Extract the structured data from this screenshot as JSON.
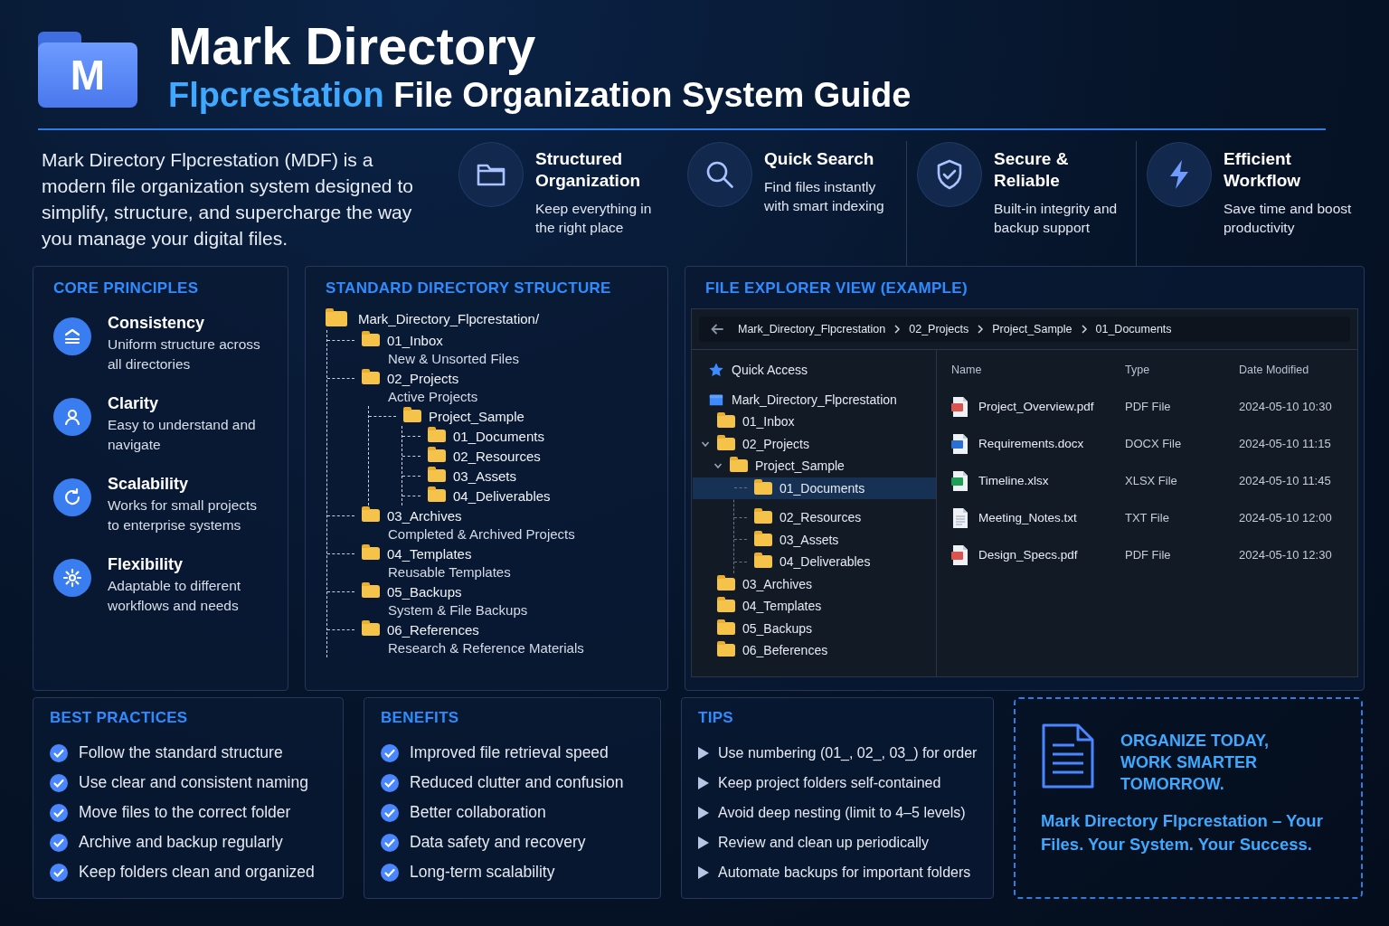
{
  "header": {
    "logo_letter": "M",
    "title": "Mark Directory",
    "subtitle_accent": "Flpcrestation",
    "subtitle_rest": "File Organization System Guide"
  },
  "intro": "Mark Directory Flpcrestation (MDF) is a modern file organization system designed to simplify, structure, and supercharge the way you manage your digital files.",
  "features": [
    {
      "kind": "folder",
      "title": "Structured Organization",
      "text": "Keep everything in the right place"
    },
    {
      "kind": "search",
      "title": "Quick Search",
      "text": "Find files instantly with smart indexing"
    },
    {
      "kind": "shield",
      "title": "Secure & Reliable",
      "text": "Built-in integrity and backup support"
    },
    {
      "kind": "bolt",
      "title": "Efficient Workflow",
      "text": "Save time and boost productivity"
    }
  ],
  "core_principles": {
    "title": "CORE PRINCIPLES",
    "items": [
      {
        "kind": "consistency",
        "title": "Consistency",
        "text": "Uniform structure across all directories"
      },
      {
        "kind": "clarity",
        "title": "Clarity",
        "text": "Easy to understand and navigate"
      },
      {
        "kind": "scalability",
        "title": "Scalability",
        "text": "Works for small projects to enterprise systems"
      },
      {
        "kind": "flexibility",
        "title": "Flexibility",
        "text": "Adaptable to different workflows and needs"
      }
    ]
  },
  "directory": {
    "title": "STANDARD DIRECTORY STRUCTURE",
    "root": "Mark_Directory_Flpcrestation/",
    "children": [
      {
        "name": "01_Inbox",
        "description": "New & Unsorted Files"
      },
      {
        "name": "02_Projects",
        "description": "Active Projects",
        "children": [
          {
            "name": "Project_Sample",
            "children": [
              {
                "name": "01_Documents"
              },
              {
                "name": "02_Resources"
              },
              {
                "name": "03_Assets"
              },
              {
                "name": "04_Deliverables"
              }
            ]
          }
        ]
      },
      {
        "name": "03_Archives",
        "description": "Completed & Archived Projects"
      },
      {
        "name": "04_Templates",
        "description": "Reusable Templates"
      },
      {
        "name": "05_Backups",
        "description": "System & File Backups"
      },
      {
        "name": "06_References",
        "description": "Research & Reference Materials"
      }
    ]
  },
  "explorer": {
    "title": "FILE EXPLORER VIEW (EXAMPLE)",
    "breadcrumb": [
      "Mark_Directory_Flpcrestation",
      "02_Projects",
      "Project_Sample",
      "01_Documents"
    ],
    "quick_access": "Quick Access",
    "tree_root": "Mark_Directory_Flpcrestation",
    "tree": [
      {
        "name": "01_Inbox",
        "expanded": false,
        "selected": false
      },
      {
        "name": "02_Projects",
        "expanded": true,
        "selected": false,
        "children": [
          {
            "name": "Project_Sample",
            "expanded": true,
            "selected": false,
            "children": [
              {
                "name": "01_Documents",
                "selected": true
              },
              {
                "name": "02_Resources",
                "selected": false
              },
              {
                "name": "03_Assets",
                "selected": false
              },
              {
                "name": "04_Deliverables",
                "selected": false
              }
            ]
          }
        ]
      },
      {
        "name": "03_Archives",
        "expanded": false,
        "selected": false
      },
      {
        "name": "04_Templates",
        "expanded": false,
        "selected": false
      },
      {
        "name": "05_Backups",
        "expanded": false,
        "selected": false
      },
      {
        "name": "06_Beferences",
        "expanded": false,
        "selected": false
      }
    ],
    "columns": [
      "Name",
      "Type",
      "Date Modified"
    ],
    "files": [
      {
        "kind": "pdf",
        "name": "Project_Overview.pdf",
        "type": "PDF File",
        "modified": "2024-05-10 10:30"
      },
      {
        "kind": "docx",
        "name": "Requirements.docx",
        "type": "DOCX File",
        "modified": "2024-05-10 11:15"
      },
      {
        "kind": "xlsx",
        "name": "Timeline.xlsx",
        "type": "XLSX File",
        "modified": "2024-05-10 11:45"
      },
      {
        "kind": "txt",
        "name": "Meeting_Notes.txt",
        "type": "TXT File",
        "modified": "2024-05-10 12:00"
      },
      {
        "kind": "pdf",
        "name": "Design_Specs.pdf",
        "type": "PDF File",
        "modified": "2024-05-10 12:30"
      }
    ]
  },
  "best_practices": {
    "title": "BEST PRACTICES",
    "items": [
      "Follow the standard structure",
      "Use clear and consistent naming",
      "Move files to the correct folder",
      "Archive and backup regularly",
      "Keep folders clean and organized"
    ]
  },
  "benefits": {
    "title": "BENEFITS",
    "items": [
      "Improved file retrieval speed",
      "Reduced clutter and confusion",
      "Better collaboration",
      "Data safety and recovery",
      "Long-term scalability"
    ]
  },
  "tips": {
    "title": "TIPS",
    "items": [
      "Use numbering (01_, 02_, 03_) for order",
      "Keep project folders self-contained",
      "Avoid deep nesting (limit to 4–5 levels)",
      "Review and clean up periodically",
      "Automate backups for important folders"
    ]
  },
  "cta": {
    "headline": "ORGANIZE TODAY, WORK SMARTER TOMORROW.",
    "tagline": "Mark Directory Flpcrestation – Your Files. Your System. Your Success."
  }
}
